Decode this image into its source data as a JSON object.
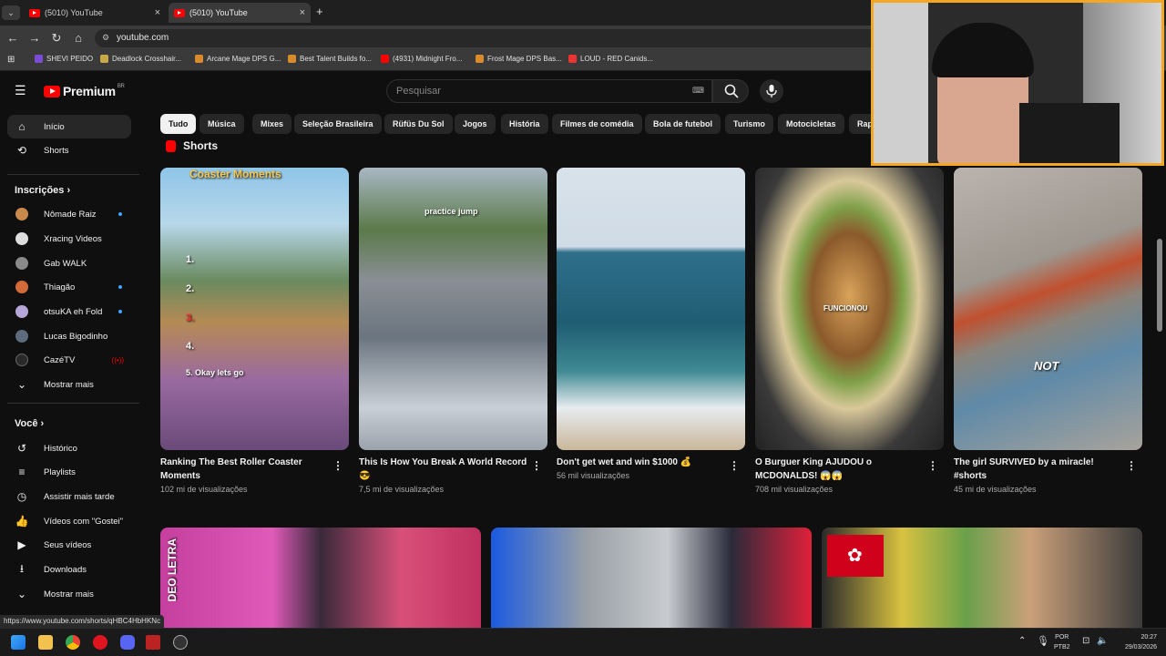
{
  "browser": {
    "tabs": [
      {
        "title": "(5010) YouTube",
        "active": false
      },
      {
        "title": "(5010) YouTube",
        "active": true
      }
    ],
    "new_tab": "+",
    "tab_menu": "⌄",
    "url": "youtube.com",
    "bookmarks": [
      "SHEVI PEIDO",
      "Deadlock Crosshair...",
      "Arcane Mage DPS G...",
      "Best Talent Builds fo...",
      "(4931) Midnight Fro...",
      "Frost Mage DPS Bas...",
      "LOUD - RED Canids..."
    ],
    "status_url": "https://www.youtube.com/shorts/qHBC4HbHKNc"
  },
  "header": {
    "logo_text": "Premium",
    "region": "BR",
    "search_placeholder": "Pesquisar"
  },
  "sidebar": {
    "main": [
      {
        "label": "Início",
        "icon": "home-icon"
      },
      {
        "label": "Shorts",
        "icon": "shorts-icon"
      }
    ],
    "subs_header": "Inscrições",
    "subs": [
      {
        "label": "Nômade Raiz",
        "color": "#c88a4a",
        "badge": "dot"
      },
      {
        "label": "Xracing Videos",
        "color": "#dddddd",
        "badge": ""
      },
      {
        "label": "Gab WALK",
        "color": "#8a8a8a",
        "badge": ""
      },
      {
        "label": "Thiagão",
        "color": "#d46a3a",
        "badge": "dot"
      },
      {
        "label": "otsuKA eh Fold",
        "color": "#b7a6d8",
        "badge": "dot"
      },
      {
        "label": "Lucas Bigodinho",
        "color": "#5d6b7d",
        "badge": ""
      },
      {
        "label": "CazéTV",
        "color": "#2a2a2a",
        "badge": "live"
      }
    ],
    "subs_more": "Mostrar mais",
    "you_header": "Você",
    "you": [
      {
        "label": "Histórico",
        "icon": "history-icon"
      },
      {
        "label": "Playlists",
        "icon": "playlist-icon"
      },
      {
        "label": "Assistir mais tarde",
        "icon": "clock-icon"
      },
      {
        "label": "Vídeos com \"Gostei\"",
        "icon": "like-icon"
      },
      {
        "label": "Seus vídeos",
        "icon": "video-icon"
      },
      {
        "label": "Downloads",
        "icon": "download-icon"
      }
    ],
    "you_more": "Mostrar mais"
  },
  "chips": [
    "Tudo",
    "Música",
    "Mixes",
    "Seleção Brasileira",
    "Rüfüs Du Sol",
    "Jogos",
    "História",
    "Filmes de comédia",
    "Bola de futebol",
    "Turismo",
    "Motocicletas",
    "Rap"
  ],
  "shorts_section": {
    "title": "Shorts",
    "items": [
      {
        "title": "Ranking The Best Roller Coaster Moments",
        "views": "102 mi de visualizações",
        "overlay": "Coaster Moments"
      },
      {
        "title": "This Is How You Break A World Record 😎",
        "views": "7,5 mi de visualizações",
        "overlay": "practice jump"
      },
      {
        "title": "Don't get wet and win $1000 💰",
        "views": "56 mil visualizações",
        "overlay": ""
      },
      {
        "title": "O Burguer King AJUDOU o MCDONALDS! 😱😱",
        "views": "708 mil visualizações",
        "overlay": "FUNCIONOU"
      },
      {
        "title": "The girl SURVIVED by a miracle! #shorts",
        "views": "45 mi de visualizações",
        "overlay": "NOT"
      }
    ]
  },
  "thumb_overlay_extra": {
    "coaster_list": [
      "1.",
      "2.",
      "3.",
      "4.",
      "5. Okay lets go"
    ],
    "video1_side": "DEO LETRA"
  },
  "taskbar": {
    "lang": "POR",
    "layout": "PTB2",
    "time": "20:27",
    "date": "29/03/2026"
  }
}
